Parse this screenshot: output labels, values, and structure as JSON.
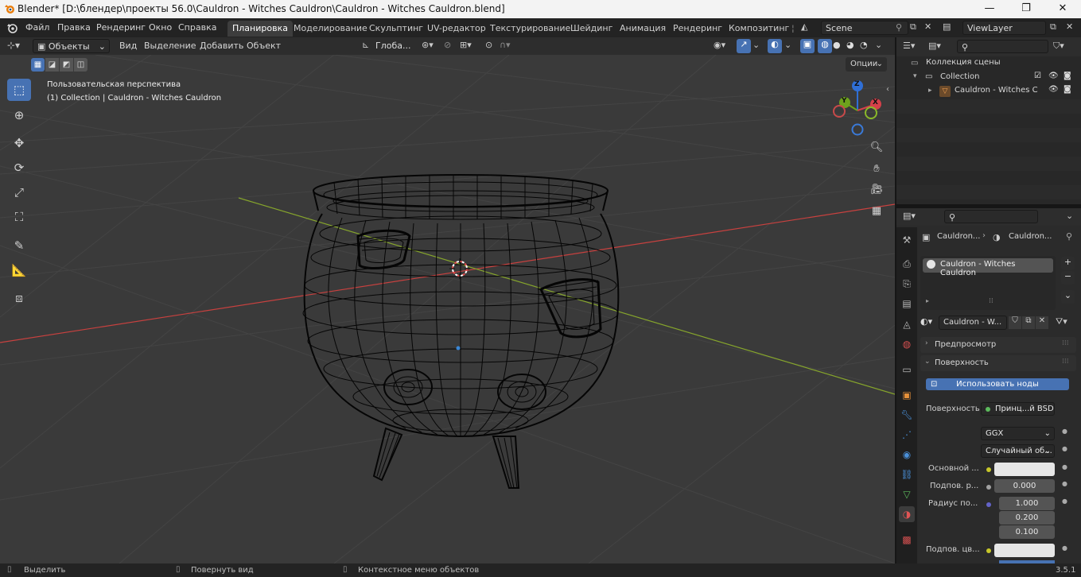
{
  "window": {
    "title": "Blender* [D:\\блендер\\проекты 56.0\\Cauldron - Witches Cauldron\\Cauldron - Witches Cauldron.blend]",
    "minimize": "—",
    "maximize": "❐",
    "close": "✕"
  },
  "menu": {
    "items": [
      "Файл",
      "Правка",
      "Рендеринг",
      "Окно",
      "Справка"
    ]
  },
  "workspaces": {
    "tabs": [
      "Планировка",
      "Моделирование",
      "Скульптинг",
      "UV-редактор",
      "Текстурирование",
      "Шейдинг",
      "Анимация",
      "Рендеринг",
      "Композитинг"
    ],
    "active": "Планировка"
  },
  "scene": {
    "name": "Scene",
    "view_layer": "ViewLayer"
  },
  "viewport_header": {
    "mode": "Объекты",
    "menus": [
      "Вид",
      "Выделение",
      "Добавить",
      "Объект"
    ],
    "transform_orientation": "Глоба...",
    "options_label": "Опции"
  },
  "viewport": {
    "view_name": "Пользовательская перспектива",
    "collection_info": "(1) Collection | Cauldron - Witches Cauldron",
    "gizmo_axes": {
      "x": "X",
      "y": "Y",
      "z": "Z"
    },
    "colors": {
      "background": "#3a3a3a",
      "x_axis": "#c8413f",
      "y_axis": "#86a52c",
      "wire": "#050505",
      "grid": "#444444"
    }
  },
  "outliner": {
    "root": "Коллекция сцены",
    "collection": "Collection",
    "object": "Cauldron - Witches C"
  },
  "properties": {
    "breadcrumb": [
      "Cauldron...",
      "Cauldron..."
    ],
    "material_slot": "Cauldron - Witches Cauldron",
    "material_name": "Cauldron - W...",
    "panels": {
      "preview": "Предпросмотр",
      "surface": "Поверхность"
    },
    "use_nodes_button": "Использовать ноды",
    "surface_label": "Поверхность",
    "surface_value": "Принц...й BSDF",
    "distribution": "GGX",
    "subsurface_method": "Случайный об...",
    "rows": [
      {
        "label": "Основной ...",
        "value": ""
      },
      {
        "label": "Подпов. р...",
        "value": "0.000"
      },
      {
        "label": "Радиус по...",
        "value": "1.000"
      },
      {
        "label": "",
        "value": "0.200"
      },
      {
        "label": "",
        "value": "0.100"
      },
      {
        "label": "Подпов. цв...",
        "value": ""
      }
    ]
  },
  "statusbar": {
    "select": "Выделить",
    "rotate": "Повернуть вид",
    "context": "Контекстное меню объектов",
    "version": "3.5.1"
  }
}
